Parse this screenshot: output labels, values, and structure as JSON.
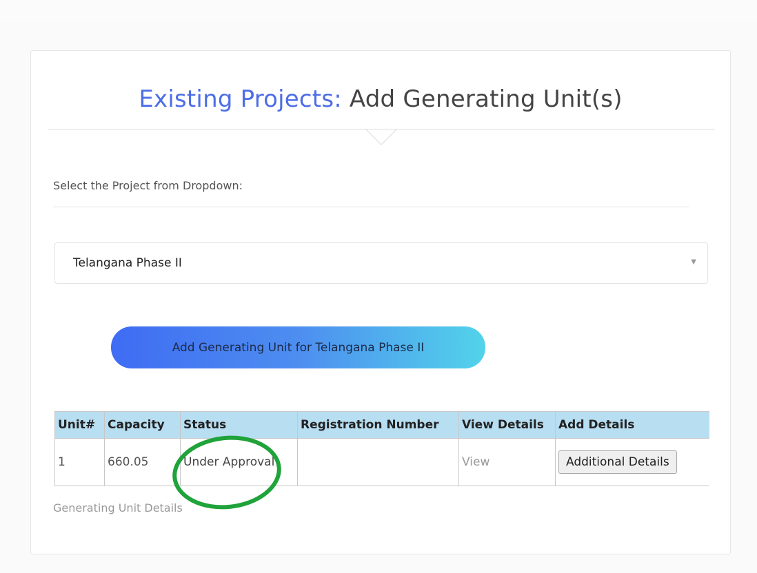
{
  "header": {
    "title_accent": "Existing Projects:",
    "title_rest": " Add Generating Unit(s)"
  },
  "project_selector": {
    "label": "Select the Project from Dropdown:",
    "selected_value": "Telangana Phase II",
    "caret_glyph": "▼"
  },
  "add_unit_button": {
    "label": "Add Generating Unit for Telangana Phase II"
  },
  "units_table": {
    "columns": [
      "Unit#",
      "Capacity",
      "Status",
      "Registration Number",
      "View Details",
      "Add Details"
    ],
    "rows": [
      {
        "unit": "1",
        "capacity": "660.05",
        "status": "Under Approval",
        "registration_number": "",
        "view_label": "View",
        "add_details_label": "Additional Details"
      }
    ]
  },
  "footer": {
    "note": "Generating Unit Details"
  },
  "colors": {
    "title_accent": "#4d6de6",
    "table_header_bg": "#b8def2",
    "button_gradient_start": "#3f6cf3",
    "button_gradient_end": "#52d3ea",
    "annotation_circle": "#1fa33a"
  }
}
